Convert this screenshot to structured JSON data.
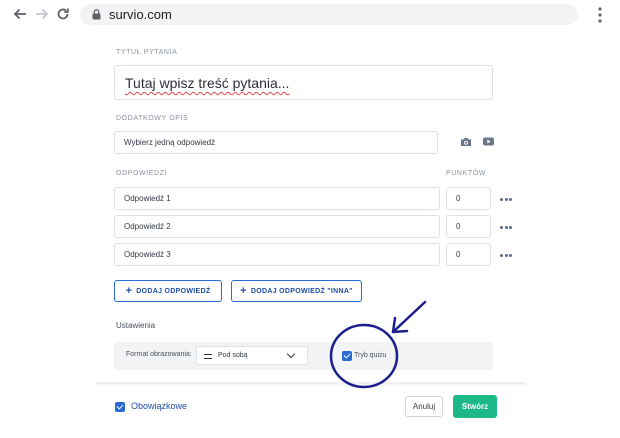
{
  "browser": {
    "url": "survio.com"
  },
  "form": {
    "question_label": "TYTUŁ PYTANIA",
    "question_value": "Tutaj wpisz treść pytania...",
    "description_label": "DODATKOWY OPIS",
    "description_value": "Wybierz jedną odpowiedź",
    "answers_label": "ODPOWIEDZI",
    "points_label": "PUNKTÓW",
    "answers": [
      {
        "text": "Odpowiedź 1",
        "points": "0"
      },
      {
        "text": "Odpowiedź 2",
        "points": "0"
      },
      {
        "text": "Odpowiedź 3",
        "points": "0"
      }
    ],
    "add_answer_label": "DODAJ ODPOWIEDŹ",
    "add_other_label": "DODAJ ODPOWIEDŹ \"INNA\""
  },
  "settings": {
    "title": "Ustawienia",
    "format_label": "Format obrazowania:",
    "format_value": "Pod sobą",
    "quiz_label": "Tryb quizu",
    "quiz_checked": true
  },
  "footer": {
    "required_label": "Obowiązkowe",
    "required_checked": true,
    "cancel_label": "Anuluj",
    "create_label": "Stwórz"
  },
  "colors": {
    "accent": "#2a6bd1",
    "create_button": "#1db888",
    "annotation": "#1a1f8c"
  },
  "icons": {
    "back": "arrow-left-icon",
    "forward": "arrow-right-icon",
    "reload": "reload-icon",
    "lock": "lock-icon",
    "menu": "kebab-menu-icon",
    "camera": "camera-icon",
    "video": "video-icon",
    "more": "more-dots-icon"
  }
}
